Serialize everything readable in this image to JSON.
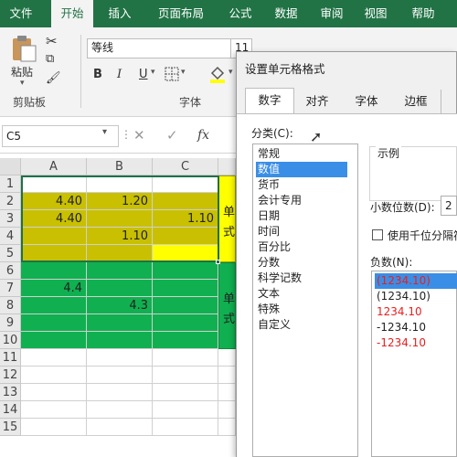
{
  "ribbon": {
    "tabs": [
      "文件",
      "开始",
      "插入",
      "页面布局",
      "公式",
      "数据",
      "审阅",
      "视图",
      "帮助"
    ],
    "active_tab": "开始",
    "clipboard": {
      "paste_label": "粘贴",
      "group_label": "剪贴板"
    },
    "font": {
      "name": "等线",
      "size": "11",
      "group_label": "字体",
      "bold": "B",
      "italic": "I",
      "underline": "U"
    }
  },
  "formula_bar": {
    "name_box": "C5",
    "cancel": "✕",
    "enter": "✓",
    "fx": "fx"
  },
  "sheet": {
    "columns": [
      "A",
      "B",
      "C"
    ],
    "rows": [
      "1",
      "2",
      "3",
      "4",
      "5",
      "6",
      "7",
      "8",
      "9",
      "10",
      "11",
      "12",
      "13",
      "14",
      "15"
    ],
    "cells": {
      "A2": "4.40",
      "B2": "1.20",
      "A3": "4.40",
      "C3": "1.10",
      "B4": "1.10",
      "A7": "4.4",
      "B8": "4.3"
    },
    "side_text_1": [
      "单",
      "式"
    ],
    "side_text_2": [
      "单",
      "式"
    ],
    "colors": {
      "olive": "#c8c000",
      "yellow": "#ffff00",
      "green": "#10b050"
    }
  },
  "dialog": {
    "title": "设置单元格格式",
    "tabs": [
      "数字",
      "对齐",
      "字体",
      "边框"
    ],
    "active_tab": "数字",
    "category_label": "分类(C):",
    "categories": [
      "常规",
      "数值",
      "货币",
      "会计专用",
      "日期",
      "时间",
      "百分比",
      "分数",
      "科学记数",
      "文本",
      "特殊",
      "自定义"
    ],
    "selected_category": "数值",
    "sample_label": "示例",
    "decimal_label": "小数位数(D):",
    "decimal_value": "2",
    "thousands_label": "使用千位分隔符",
    "negative_label": "负数(N):",
    "negatives": [
      "(1234.10)",
      "(1234.10)",
      "1234.10",
      "-1234.10",
      "-1234.10"
    ],
    "negative_colors": [
      "#e82020",
      "#222222",
      "#e82020",
      "#222222",
      "#e82020"
    ]
  }
}
